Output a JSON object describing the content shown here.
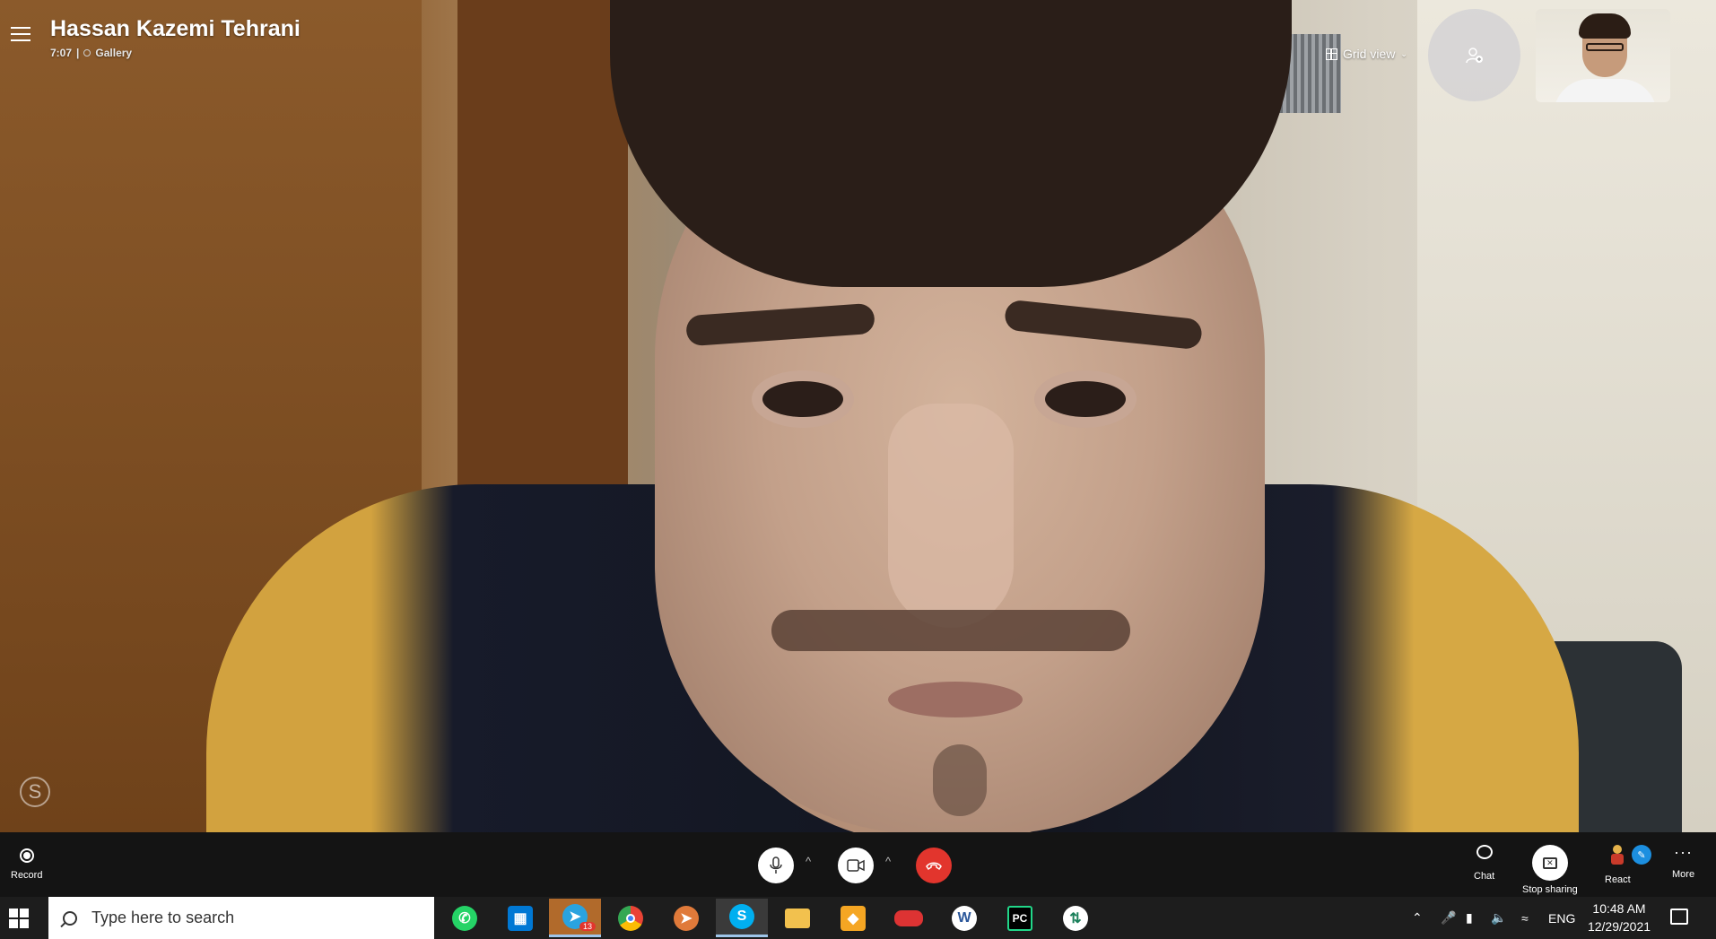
{
  "call": {
    "title": "Hassan Kazemi Tehrani",
    "duration": "7:07",
    "separator": "|",
    "view_mode": "Gallery"
  },
  "header": {
    "grid_view_label": "Grid view"
  },
  "controls": {
    "record_label": "Record",
    "chat_label": "Chat",
    "stop_sharing_label": "Stop sharing",
    "react_label": "React",
    "more_label": "More",
    "more_glyph": "···",
    "mic_caret": "^",
    "video_caret": "^"
  },
  "taskbar": {
    "search_placeholder": "Type here to search",
    "telegram_badge": "13",
    "language": "ENG",
    "time": "10:48 AM",
    "date": "12/29/2021",
    "apps": [
      "whatsapp-icon",
      "microsoft-store-icon",
      "telegram-icon",
      "chrome-icon",
      "telegram-x-icon",
      "skype-icon",
      "file-explorer-icon",
      "anydesk-icon",
      "car-app-icon",
      "word-icon",
      "pycharm-icon",
      "sync-app-icon"
    ]
  },
  "colors": {
    "hangup": "#e2352d",
    "control_bar": "#141414",
    "taskbar": "#1d1d1d",
    "accent": "#1c8fe0"
  }
}
